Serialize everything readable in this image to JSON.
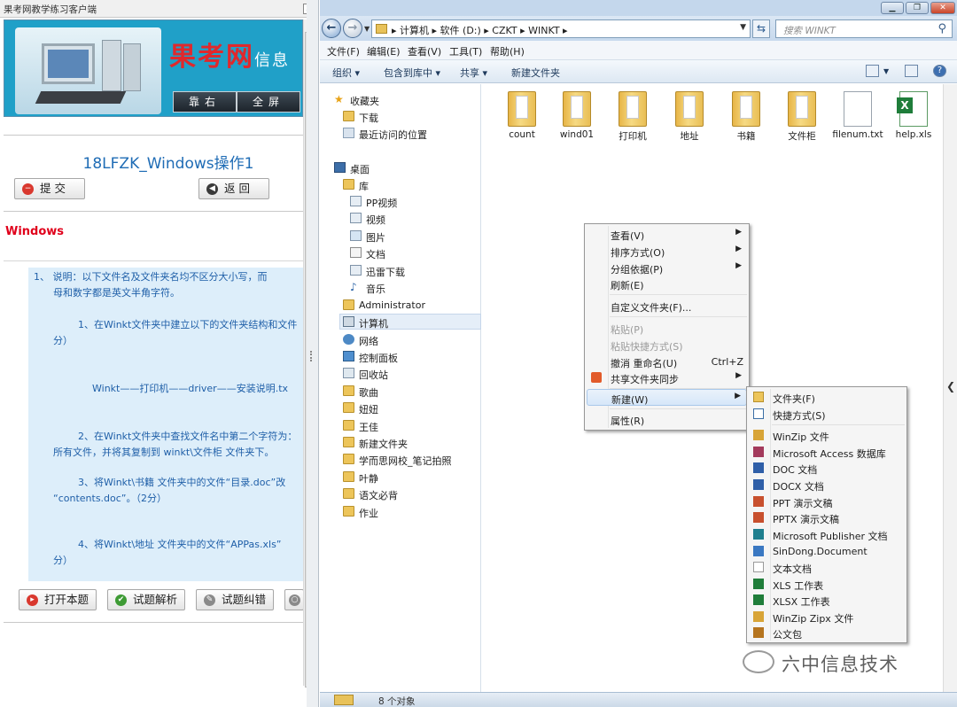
{
  "left_panel": {
    "window_title": "果考网教学练习客户端",
    "close_label": "x",
    "banner_logo": "果考网",
    "banner_logo_tail": "信息",
    "banner_buttons": [
      "靠右",
      "全屏"
    ],
    "exam_title": "18LFZK_Windows操作1",
    "submit_label": "提 交",
    "back_label": "返 回",
    "section_title": "Windows",
    "question_lines": [
      "1、    说明：以下文件名及文件夹名均不区分大小写，而",
      "母和数字都是英文半角字符。",
      "1、在Winkt文件夹中建立以下的文件夹结构和文件",
      "分）",
      "Winkt——打印机——driver——安装说明.tx",
      "2、在Winkt文件夹中查找文件名中第二个字符为：",
      "所有文件，并将其复制到 winkt\\文件柜 文件夹下。",
      "3、将Winkt\\书籍 文件夹中的文件“目录.doc”改",
      "“contents.doc”。（2分）",
      "4、将Winkt\\地址 文件夹中的文件“APPas.xls”",
      "分）"
    ],
    "bottom_buttons": [
      "打开本题",
      "试题解析",
      "试题纠错"
    ]
  },
  "explorer": {
    "address": {
      "crumbs": "▸ 计算机 ▸ 软件 (D:) ▸ CZKT ▸ WINKT ▸",
      "search_placeholder": "搜索 WINKT"
    },
    "menubar": [
      "文件(F)",
      "编辑(E)",
      "查看(V)",
      "工具(T)",
      "帮助(H)"
    ],
    "toolbar": [
      "组织 ▾",
      "包含到库中 ▾",
      "共享 ▾",
      "新建文件夹"
    ],
    "nav_items": [
      {
        "label": "收藏夹",
        "icon": "star-icon"
      },
      {
        "label": "下载",
        "icon": "download-icon"
      },
      {
        "label": "最近访问的位置",
        "icon": "recent-icon"
      },
      {
        "label": "桌面",
        "icon": "desktop-icon"
      },
      {
        "label": "库",
        "icon": "library-icon"
      },
      {
        "label": "PP视频",
        "icon": "video-icon"
      },
      {
        "label": "视频",
        "icon": "video-icon"
      },
      {
        "label": "图片",
        "icon": "picture-icon"
      },
      {
        "label": "文档",
        "icon": "document-icon"
      },
      {
        "label": "迅雷下载",
        "icon": "download-icon"
      },
      {
        "label": "音乐",
        "icon": "music-icon"
      },
      {
        "label": "Administrator",
        "icon": "user-icon"
      },
      {
        "label": "计算机",
        "icon": "computer-icon"
      },
      {
        "label": "网络",
        "icon": "network-icon"
      },
      {
        "label": "控制面板",
        "icon": "control-panel-icon"
      },
      {
        "label": "回收站",
        "icon": "recycle-bin-icon"
      },
      {
        "label": "歌曲",
        "icon": "folder-icon"
      },
      {
        "label": "妞妞",
        "icon": "folder-icon"
      },
      {
        "label": "王佳",
        "icon": "folder-icon"
      },
      {
        "label": "新建文件夹",
        "icon": "folder-icon"
      },
      {
        "label": "学而思网校_笔记拍照",
        "icon": "folder-icon"
      },
      {
        "label": "叶静",
        "icon": "folder-icon"
      },
      {
        "label": "语文必背",
        "icon": "folder-icon"
      },
      {
        "label": "作业",
        "icon": "folder-icon"
      }
    ],
    "files": [
      {
        "name": "count",
        "type": "folder"
      },
      {
        "name": "wind01",
        "type": "folder"
      },
      {
        "name": "打印机",
        "type": "folder"
      },
      {
        "name": "地址",
        "type": "folder"
      },
      {
        "name": "书籍",
        "type": "folder"
      },
      {
        "name": "文件柜",
        "type": "folder"
      },
      {
        "name": "filenum.txt",
        "type": "txt"
      },
      {
        "name": "help.xls",
        "type": "xls"
      }
    ],
    "status": "8 个对象"
  },
  "context_menu": [
    {
      "label": "查看(V)",
      "arrow": true
    },
    {
      "label": "排序方式(O)",
      "arrow": true
    },
    {
      "label": "分组依据(P)",
      "arrow": true
    },
    {
      "label": "刷新(E)"
    },
    {
      "label": "自定义文件夹(F)..."
    },
    {
      "label": "粘贴(P)",
      "disabled": true
    },
    {
      "label": "粘贴快捷方式(S)",
      "disabled": true
    },
    {
      "label": "撤消 重命名(U)",
      "shortcut": "Ctrl+Z"
    },
    {
      "label": "共享文件夹同步",
      "arrow": true
    },
    {
      "label": "新建(W)",
      "arrow": true,
      "highlight": true
    },
    {
      "label": "属性(R)"
    }
  ],
  "new_submenu": [
    "文件夹(F)",
    "快捷方式(S)",
    "WinZip 文件",
    "Microsoft Access 数据库",
    "DOC 文档",
    "DOCX 文档",
    "PPT 演示文稿",
    "PPTX 演示文稿",
    "Microsoft Publisher 文档",
    "SinDong.Document",
    "文本文档",
    "XLS 工作表",
    "XLSX 工作表",
    "WinZip Zipx 文件",
    "公文包"
  ],
  "watermark": "六中信息技术",
  "colors": {
    "accent_red": "#e0001b",
    "question_bg": "#ddeefa",
    "title_blue": "#1f6cb5"
  }
}
